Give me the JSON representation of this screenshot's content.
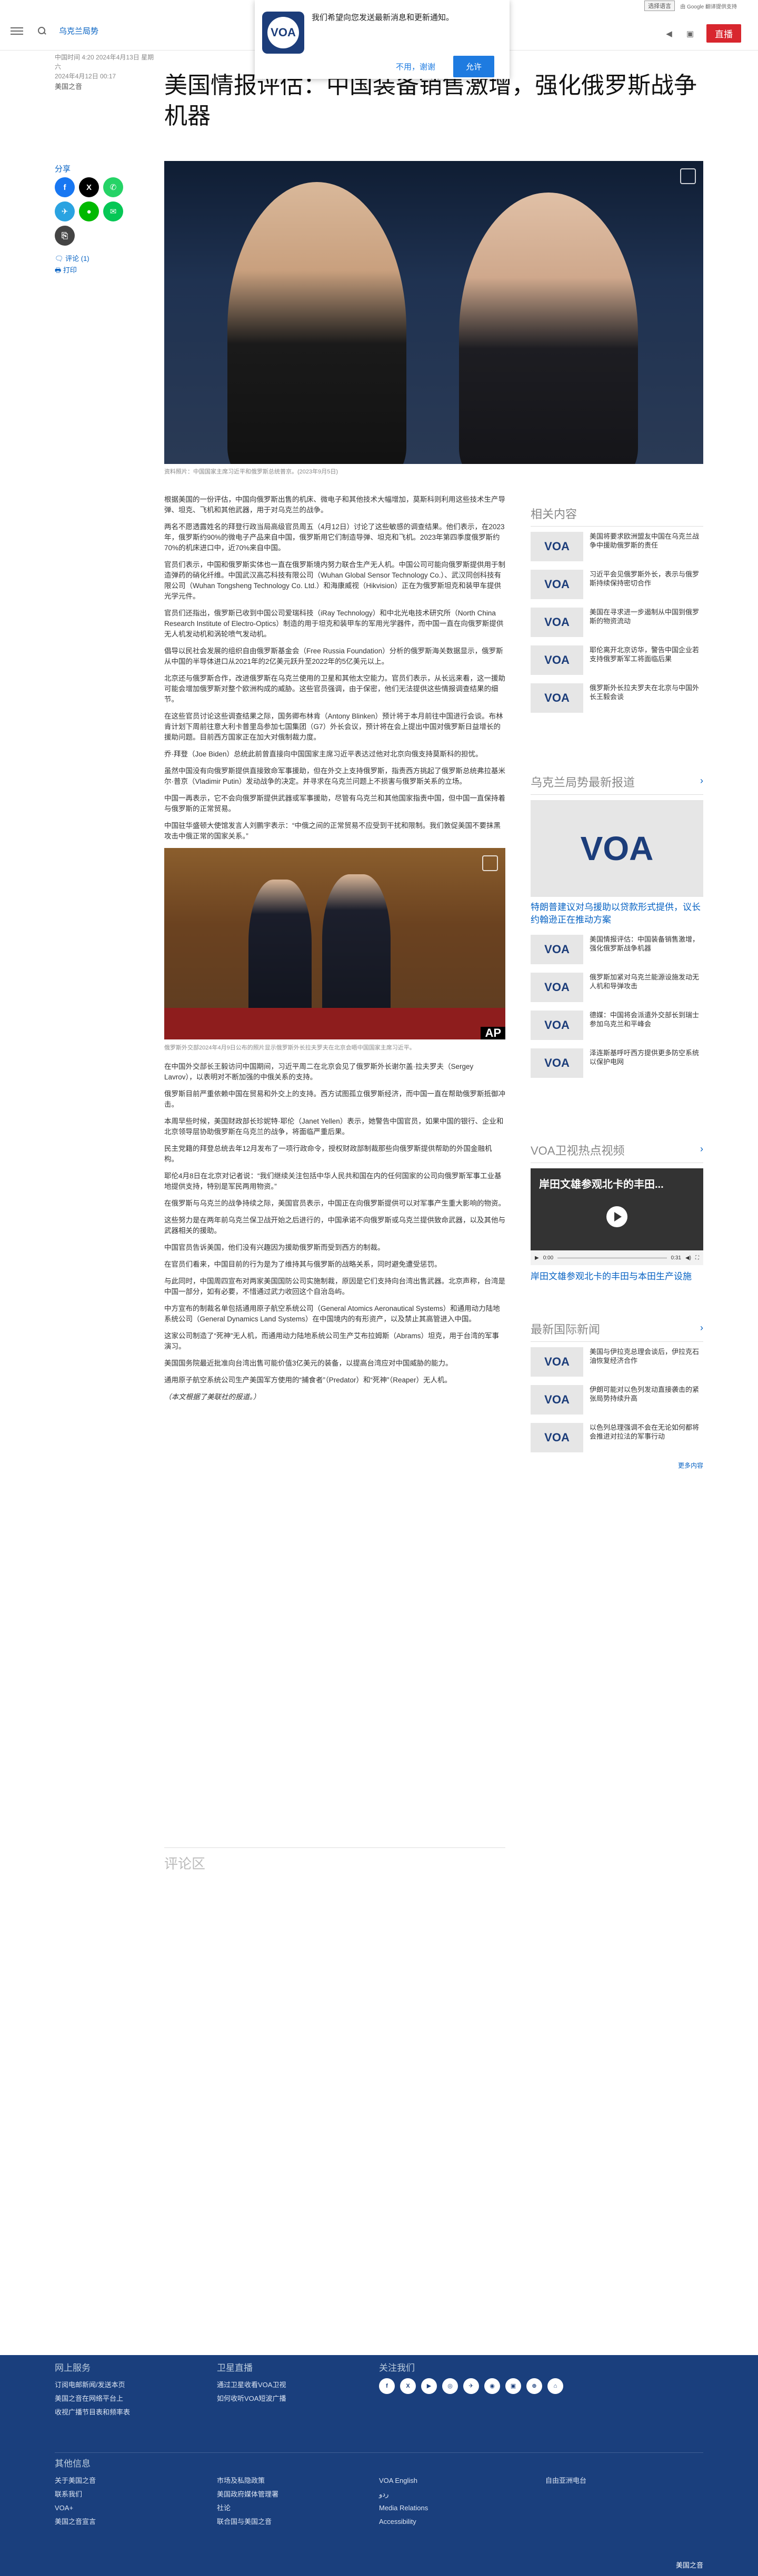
{
  "util": {
    "language_select": "选择语言",
    "google": "由 Google 翻译提供支持"
  },
  "header": {
    "section": "乌克兰局势",
    "live_label": "直播"
  },
  "notification": {
    "message": "我们希望向您发送最新消息和更新通知。",
    "decline": "不用，谢谢",
    "accept": "允许"
  },
  "meta": {
    "dates": "中国时间 4:20 2024年4月13日 星期六",
    "updated": "2024年4月12日 00:17",
    "rubric": "美国之音"
  },
  "title": "美国情报评估：中国装备销售激增，强化俄罗斯战争机器",
  "share": {
    "label": "分享",
    "comments": "评论 (1)",
    "print": "打印"
  },
  "hero_caption": "资料照片：中国国家主席习近平和俄罗斯总统普京。(2023年9月5日)",
  "body_1": [
    "根据美国的一份评估，中国向俄罗斯出售的机床、微电子和其他技术大幅增加，莫斯科则利用这些技术生产导弹、坦克、飞机和其他武器，用于对乌克兰的战争。",
    "两名不愿透露姓名的拜登行政当局高级官员周五（4月12日）讨论了这些敏感的调查结果。他们表示，在2023年，俄罗斯约90%的微电子产品来自中国，俄罗斯用它们制造导弹、坦克和飞机。2023年第四季度俄罗斯约70%的机床进口中，近70%来自中国。",
    "官员们表示，中国和俄罗斯实体也一直在俄罗斯境内努力联合生产无人机。中国公司可能向俄罗斯提供用于制造弹药的硝化纤维。中国武汉高芯科技有限公司（Wuhan Global Sensor Technology Co.）、武汉同创科技有限公司（Wuhan Tongsheng Technology Co. Ltd.）和海康威视（Hikvision）正在为俄罗斯坦克和装甲车提供光学元件。",
    "官员们还指出，俄罗斯已收到中国公司爱瑞科技（iRay Technology）和中北光电技术研究所（North China Research Institute of Electro-Optics）制造的用于坦克和装甲车的军用光学器件，而中国一直在向俄罗斯提供无人机发动机和涡轮喷气发动机。",
    "倡导以民社会发展的组织自由俄罗斯基金会（Free Russia Foundation）分析的俄罗斯海关数据显示，俄罗斯从中国的半导体进口从2021年的2亿美元跃升至2022年的5亿美元以上。",
    "北京还与俄罗斯合作，改进俄罗斯在乌克兰使用的卫星和其他太空能力。官员们表示，从长远来看，这一援助可能会增加俄罗斯对整个欧洲构成的威胁。这些官员强调，由于保密，他们无法提供这些情报调查结果的细节。",
    "在这些官员讨论这些调查结果之际，国务卿布林肯（Antony Blinken）预计将于本月前往中国进行会谈。布林肯计划下周前往意大利卡普里岛参加七国集团（G7）外长会议，预计将在会上提出中国对俄罗斯日益增长的援助问题。目前西方国家正在加大对俄制裁力度。",
    "乔·拜登（Joe Biden）总统此前曾直接向中国国家主席习近平表达过他对北京向俄支持莫斯科的担忧。",
    "虽然中国没有向俄罗斯提供直接致命军事援助，但在外交上支持俄罗斯，指责西方挑起了俄罗斯总统弗拉基米尔·普京（Vladimir Putin）发动战争的决定。并寻求在乌克兰问题上不损害与俄罗斯关系的立场。",
    "中国一再表示，它不会向俄罗斯提供武器或军事援助，尽管有乌克兰和其他国家指责中国，但中国一直保持着与俄罗斯的正常贸易。",
    "中国驻华盛顿大使馆发言人刘鹏宇表示：“中俄之间的正常贸易不应受到干扰和限制。我们敦促美国不要抹黑攻击中俄正常的国家关系。”"
  ],
  "inline_caption": "俄罗斯外交部2024年4月9日公布的照片显示俄罗斯外长拉夫罗夫在北京会晤中国国家主席习近平。",
  "body_2": [
    "在中国外交部长王毅访问中国期间，习近平周二在北京会见了俄罗斯外长谢尔盖·拉夫罗夫（Sergey Lavrov），以表明对不断加强的中俄关系的支持。",
    "俄罗斯目前严重依赖中国在贸易和外交上的支持。西方试图孤立俄罗斯经济，而中国一直在帮助俄罗斯抵御冲击。",
    "本周早些时候，美国财政部长珍妮特·耶伦（Janet Yellen）表示，她警告中国官员，如果中国的银行、企业和北京领导层协助俄罗斯在乌克兰的战争，将面临严重后果。",
    "民主党籍的拜登总统去年12月发布了一项行政命令，授权财政部制裁那些向俄罗斯提供帮助的外国金融机构。",
    "耶伦4月8日在北京对记者说：“我们继续关注包括中华人民共和国在内的任何国家的公司向俄罗斯军事工业基地提供支持，特别是军民两用物资。”",
    "在俄罗斯与乌克兰的战争持续之际，美国官员表示，中国正在向俄罗斯提供可以对军事产生重大影响的物资。",
    "这些努力是在两年前乌克兰保卫战开始之后进行的，中国承诺不向俄罗斯或乌克兰提供致命武器，以及其他与武器相关的援助。",
    "中国官员告诉美国，他们没有兴趣因为援助俄罗斯而受到西方的制裁。",
    "在官员们看来，中国目前的行为是为了维持其与俄罗斯的战略关系，同时避免遭受惩罚。",
    "与此同时，中国周四宣布对两家美国国防公司实施制裁，原因是它们支持向台湾出售武器。北京声称，台湾是中国一部分，如有必要，不惜通过武力收回这个自治岛屿。",
    "中方宣布的制裁名单包括通用原子航空系统公司（General Atomics Aeronautical Systems）和通用动力陆地系统公司（General Dynamics Land Systems）在中国境内的有形资产，以及禁止其高管进入中国。",
    "这家公司制造了“死神”无人机，而通用动力陆地系统公司生产艾布拉姆斯（Abrams）坦克，用于台湾的军事演习。",
    "美国国务院最近批准向台湾出售可能价值3亿美元的装备，以提高台湾应对中国威胁的能力。",
    "通用原子航空系统公司生产美国军方使用的“捕食者”（Predator）和“死神”（Reaper）无人机。"
  ],
  "attribution": "（本文根据了美联社的报道。）",
  "comments_title": "评论区",
  "rail": {
    "related_title": "相关内容",
    "related": [
      "美国将要求欧洲盟友中国在乌克兰战争中援助俄罗斯的责任",
      "习近平会见俄罗斯外长，表示与俄罗斯持续保持密切合作",
      "美国在寻求进一步遏制从中国到俄罗斯的物资流动",
      "耶伦离开北京访华，警告中国企业若支持俄罗斯军工将面临后果",
      "俄罗斯外长拉夫罗夫在北京与中国外长王毅会谈"
    ],
    "ukraine_title": "乌克兰局势最新报道",
    "ukraine_lead": "特朗普建议对乌援助以贷款形式提供，议长约翰逊正在推动方案",
    "ukraine": [
      "美国情报评估：中国装备销售激增，强化俄罗斯战争机器",
      "俄罗斯加紧对乌克兰能源设施发动无人机和导弹攻击",
      "德媒：中国将会派遣外交部长到瑞士参加乌克兰和平峰会",
      "泽连斯基呼吁西方提供更多防空系统以保护电网"
    ],
    "tv_title": "VOA卫视热点视频",
    "video_overlay": "岸田文雄参观北卡的丰田...",
    "video_time_current": "0:00",
    "video_time_total": "0:31",
    "video_caption": "岸田文雄参观北卡的丰田与本田生产设施",
    "intl_title": "最新国际新闻",
    "intl": [
      "美国与伊拉克总理会谈后，伊拉克石油恢复经济合作",
      "伊朗可能对以色列发动直接袭击的紧张局势持续升高",
      "以色列总理强调不会在无论如何都将会推进对拉法的军事行动"
    ],
    "more": "更多内容"
  },
  "footer": {
    "col1_title": "网上服务",
    "col1": [
      "订阅电邮新闻/发送本页",
      "美国之音在网络平台上",
      "收视广播节目表和频率表"
    ],
    "col2_title": "卫星直播",
    "col2": [
      "通过卫星收看VOA卫视",
      "如何收听VOA短波广播"
    ],
    "col3_title": "关注我们",
    "social": [
      "f",
      "X",
      "▶",
      "◎",
      "✈",
      "◉",
      "▣",
      "⊕",
      "⌂"
    ],
    "more_title": "其他信息",
    "links_a": [
      "关于美国之音",
      "联系我们",
      "VOA+",
      "美国之音宣言"
    ],
    "links_b": [
      "市场及私隐政策",
      "美国政府媒体管理署",
      "社论",
      "联合国与美国之音"
    ],
    "links_c": [
      "VOA English",
      "ردو",
      "Media Relations",
      "Accessibility"
    ],
    "links_d": [
      "自由亚洲电台"
    ],
    "copyright": "美国之音"
  }
}
